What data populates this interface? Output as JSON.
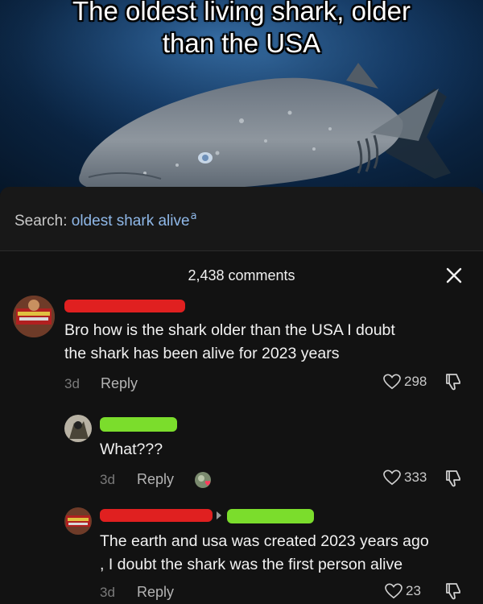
{
  "hero": {
    "caption_line1": "The oldest living shark, older",
    "caption_line2": "than the USA"
  },
  "search": {
    "label": "Search:",
    "query": "oldest shark alive",
    "icon": "search-icon"
  },
  "comments_header": {
    "count_text": "2,438 comments",
    "close_icon": "close-icon"
  },
  "comments": [
    {
      "text_line1": "Bro how is the shark older than the USA I doubt",
      "text_line2": "the shark has been alive for 2023 years",
      "time": "3d",
      "reply_label": "Reply",
      "likes": "298"
    },
    {
      "text_line1": "What???",
      "time": "3d",
      "reply_label": "Reply",
      "likes": "333"
    },
    {
      "text_line1": "The earth and usa was created 2023 years ago",
      "text_line2": ", I doubt the shark was the first person alive",
      "time": "3d",
      "reply_label": "Reply",
      "likes": "23"
    }
  ],
  "colors": {
    "background": "#121212",
    "link_blue": "#8fb8e8",
    "redaction_red": "#e02020",
    "redaction_green": "#7bdd2c"
  }
}
